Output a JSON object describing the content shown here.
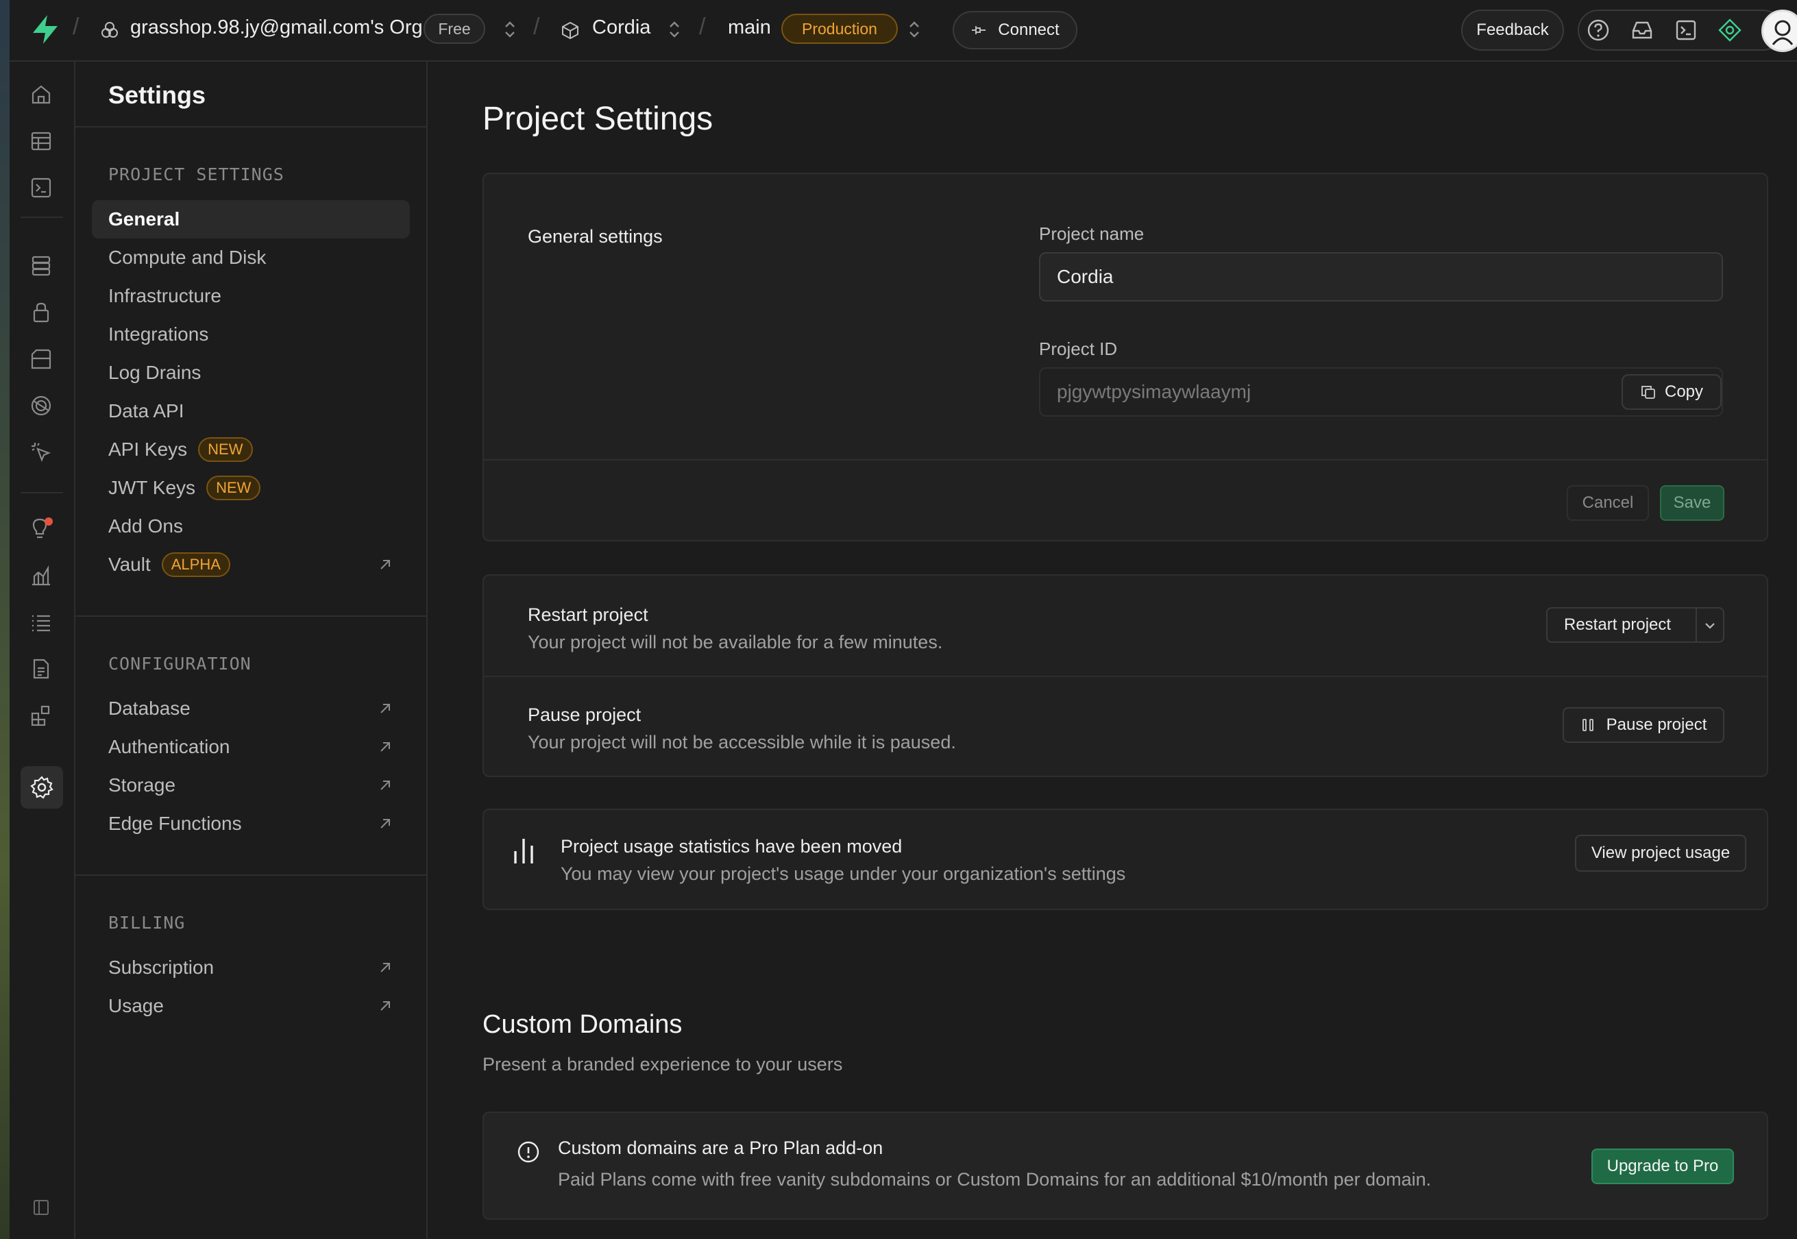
{
  "colors": {
    "accent": "#3ecf8e",
    "warning": "#f0a535",
    "upgrade_bg": "#1f6b46",
    "save_bg": "#1f4d35"
  },
  "topbar": {
    "org_name": "grasshop.98.jy@gmail.com's Org",
    "plan_badge": "Free",
    "project_name": "Cordia",
    "branch": "main",
    "env_badge": "Production",
    "connect_label": "Connect",
    "feedback_label": "Feedback",
    "icons": [
      "help-icon",
      "inbox-icon",
      "terminal-icon",
      "assistant-icon",
      "user-avatar"
    ]
  },
  "rail": {
    "icons": [
      "home-icon",
      "table-editor-icon",
      "sql-editor-icon",
      "database-icon",
      "auth-icon",
      "storage-icon",
      "realtime-icon",
      "edge-functions-icon",
      "advisors-icon",
      "reports-icon",
      "logs-icon",
      "api-docs-icon",
      "integrations-icon",
      "settings-icon",
      "collapse-sidebar-icon"
    ]
  },
  "sidebar": {
    "title": "Settings",
    "project_settings": {
      "heading": "PROJECT SETTINGS",
      "items": [
        {
          "label": "General"
        },
        {
          "label": "Compute and Disk"
        },
        {
          "label": "Infrastructure"
        },
        {
          "label": "Integrations"
        },
        {
          "label": "Log Drains"
        },
        {
          "label": "Data API"
        },
        {
          "label": "API Keys",
          "badge": "NEW"
        },
        {
          "label": "JWT Keys",
          "badge": "NEW"
        },
        {
          "label": "Add Ons"
        },
        {
          "label": "Vault",
          "badge": "ALPHA"
        }
      ]
    },
    "configuration": {
      "heading": "CONFIGURATION",
      "items": [
        {
          "label": "Database"
        },
        {
          "label": "Authentication"
        },
        {
          "label": "Storage"
        },
        {
          "label": "Edge Functions"
        }
      ]
    },
    "billing": {
      "heading": "BILLING",
      "items": [
        {
          "label": "Subscription"
        },
        {
          "label": "Usage"
        }
      ]
    }
  },
  "main": {
    "title": "Project Settings",
    "general": {
      "section_label": "General settings",
      "project_name_label": "Project name",
      "project_name_value": "Cordia",
      "project_id_label": "Project ID",
      "project_id_value": "pjgywtpysimaywlaaymj",
      "copy_label": "Copy",
      "cancel_label": "Cancel",
      "save_label": "Save"
    },
    "restart": {
      "title": "Restart project",
      "description": "Your project will not be available for a few minutes.",
      "button": "Restart project"
    },
    "pause": {
      "title": "Pause project",
      "description": "Your project will not be accessible while it is paused.",
      "button": "Pause project"
    },
    "usage_notice": {
      "title": "Project usage statistics have been moved",
      "description": "You may view your project's usage under your organization's settings",
      "button": "View project usage"
    },
    "custom_domains": {
      "title": "Custom Domains",
      "subtitle": "Present a branded experience to your users",
      "notice_title": "Custom domains are a Pro Plan add-on",
      "notice_description": "Paid Plans come with free vanity subdomains or Custom Domains for an additional $10/month per domain.",
      "upgrade_button": "Upgrade to Pro"
    }
  }
}
